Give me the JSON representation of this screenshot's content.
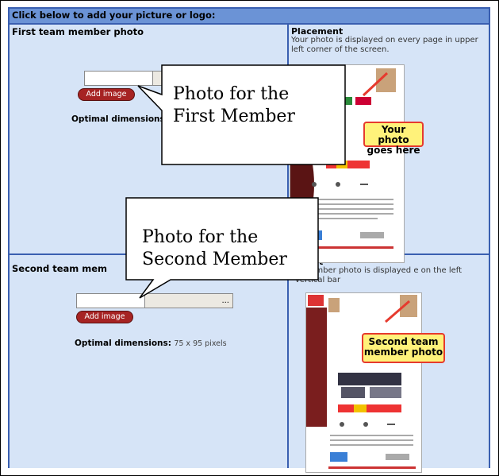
{
  "header": {
    "title": "Click below to add your picture or logo:"
  },
  "first_member": {
    "heading": "First team member photo",
    "browse_label": "...",
    "add_image_label": "Add image",
    "optimal_label": "Optimal dimensions"
  },
  "first_placement": {
    "heading": "Placement",
    "text": "Your photo is displayed on every page in upper left corner of the screen.",
    "tag": "Your photo goes here"
  },
  "second_member": {
    "heading": "Second team mem",
    "browse_label": "...",
    "add_image_label": "Add image",
    "optimal_label": "Optimal dimensions:",
    "optimal_value": "75 x 95 pixels"
  },
  "second_placement": {
    "heading": "t",
    "text": "n member photo is displayed e on the left vertical bar",
    "tag": "Second team member photo"
  },
  "callouts": {
    "first": "Photo for the First Member",
    "second": "Photo for the Second Member"
  },
  "colors": {
    "panel_border": "#3a5fb0",
    "header_bg": "#6b93d6",
    "cell_bg": "#d6e4f7",
    "add_button": "#a62323",
    "tag_bg": "#fff27a",
    "tag_border": "#e63a2e"
  }
}
